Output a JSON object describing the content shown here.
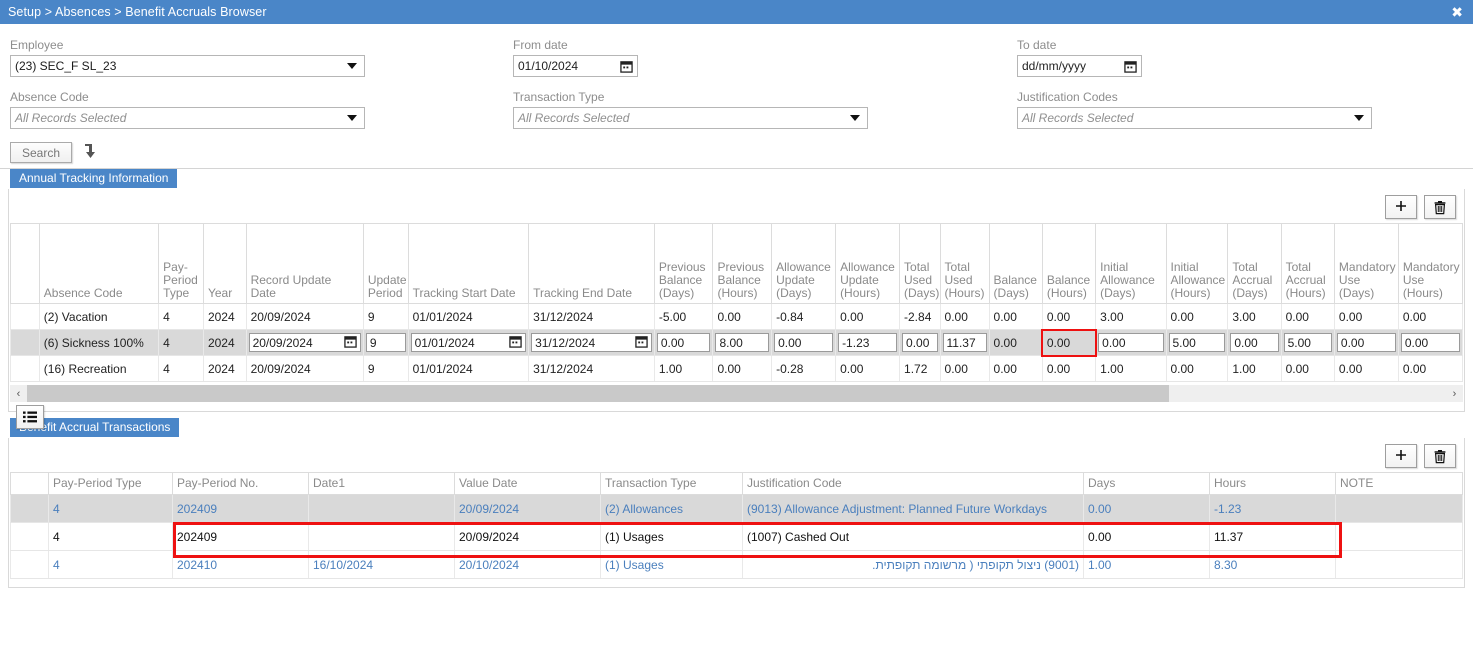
{
  "titlebar": {
    "breadcrumb": "Setup > Absences > Benefit Accruals Browser",
    "close_label": "✖"
  },
  "filters": {
    "employee": {
      "label": "Employee",
      "value": "(23) SEC_F SL_23"
    },
    "from_date": {
      "label": "From date",
      "value": "01/10/2024"
    },
    "to_date": {
      "label": "To date",
      "value": "dd/mm/yyyy"
    },
    "absence_code": {
      "label": "Absence Code",
      "value": "All Records Selected"
    },
    "transaction_type": {
      "label": "Transaction Type",
      "value": "All Records Selected"
    },
    "justification_codes": {
      "label": "Justification Codes",
      "value": "All Records Selected"
    },
    "search_button": "Search"
  },
  "tracking": {
    "tab_label": "Annual Tracking Information",
    "add_label": "+",
    "delete_label": "delete-icon",
    "columns": [
      "",
      "Absence Code",
      "Pay-Period Type",
      "Year",
      "Record Update Date",
      "Update Period",
      "Tracking Start Date",
      "Tracking End Date",
      "Previous Balance (Days)",
      "Previous Balance (Hours)",
      "Allowance Update (Days)",
      "Allowance Update (Hours)",
      "Total Used (Days)",
      "Total Used (Hours)",
      "Balance (Days)",
      "Balance (Hours)",
      "Initial Allowance (Days)",
      "Initial Allowance (Hours)",
      "Total Accrual (Days)",
      "Total Accrual (Hours)",
      "Mandatory Use (Days)",
      "Mandatory Use (Hours)"
    ],
    "rows": [
      {
        "selected": false,
        "editing": false,
        "cells": [
          "",
          "(2) Vacation",
          "4",
          "2024",
          "20/09/2024",
          "9",
          "01/01/2024",
          "31/12/2024",
          "-5.00",
          "0.00",
          "-0.84",
          "0.00",
          "-2.84",
          "0.00",
          "0.00",
          "0.00",
          "3.00",
          "0.00",
          "3.00",
          "0.00",
          "0.00",
          "0.00"
        ]
      },
      {
        "selected": true,
        "editing": true,
        "cells": [
          "",
          "(6) Sickness 100%",
          "4",
          "2024",
          "20/09/2024",
          "9",
          "01/01/2024",
          "31/12/2024",
          "0.00",
          "8.00",
          "0.00",
          "-1.23",
          "0.00",
          "11.37",
          "0.00",
          "0.00",
          "0.00",
          "5.00",
          "0.00",
          "5.00",
          "0.00",
          "0.00"
        ]
      },
      {
        "selected": false,
        "editing": false,
        "cells": [
          "",
          "(16) Recreation",
          "4",
          "2024",
          "20/09/2024",
          "9",
          "01/01/2024",
          "31/12/2024",
          "1.00",
          "0.00",
          "-0.28",
          "0.00",
          "1.72",
          "0.00",
          "0.00",
          "0.00",
          "1.00",
          "0.00",
          "1.00",
          "0.00",
          "0.00",
          "0.00"
        ]
      }
    ],
    "highlight": {
      "row": 1,
      "col": 15,
      "color": "#ee1111"
    },
    "scroll_left_arrow": "‹",
    "scroll_right_arrow": "›",
    "list_view_label": "list-view-icon"
  },
  "transactions": {
    "tab_label": "Benefit Accrual Transactions",
    "add_label": "+",
    "delete_label": "delete-icon",
    "columns": [
      "",
      "Pay-Period Type",
      "Pay-Period No.",
      "Date1",
      "Value Date",
      "Transaction Type",
      "Justification Code",
      "Days",
      "Hours",
      "NOTE"
    ],
    "rows": [
      {
        "selected": true,
        "highlight": false,
        "cells": [
          "",
          "4",
          "202409",
          "",
          "20/09/2024",
          "(2) Allowances",
          "(9013) Allowance Adjustment: Planned Future Workdays",
          "0.00",
          "-1.23",
          ""
        ]
      },
      {
        "selected": false,
        "highlight": true,
        "cells": [
          "",
          "4",
          "202409",
          "",
          "20/09/2024",
          "(1) Usages",
          "(1007) Cashed Out",
          "0.00",
          "11.37",
          ""
        ]
      },
      {
        "selected": false,
        "highlight": false,
        "cells": [
          "",
          "4",
          "202410",
          "16/10/2024",
          "20/10/2024",
          "(1) Usages",
          "(9001) ניצול תקופתי ( מרשומה תקופתית.",
          "1.00",
          "8.30",
          ""
        ]
      }
    ],
    "highlight_color": "#ee1111"
  },
  "colors": {
    "accent": "#4a86c8",
    "link": "#4a7fbd",
    "selected_row": "#d9d9d9",
    "highlight": "#ee1111"
  }
}
